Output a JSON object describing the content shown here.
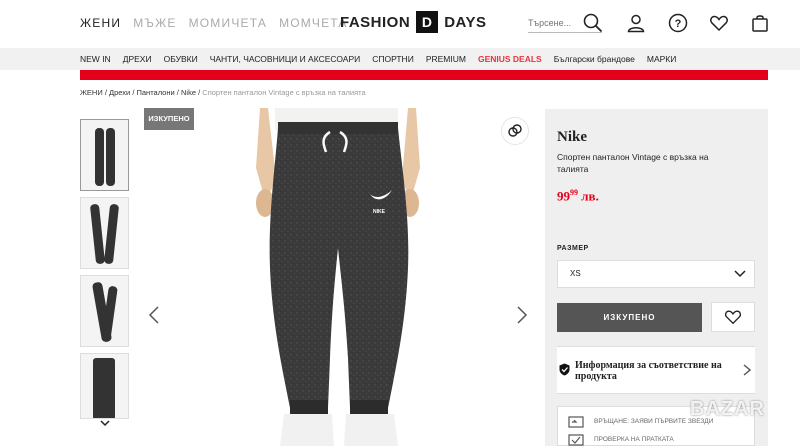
{
  "header": {
    "genders": [
      "ЖЕНИ",
      "МЪЖЕ",
      "МОМИЧЕТА",
      "МОМЧЕТА"
    ],
    "active_gender": "ЖЕНИ",
    "logo_left": "FASHION",
    "logo_right": "DAYS",
    "logo_mark": "D",
    "search_placeholder": "Търсене..."
  },
  "nav": {
    "items": [
      "NEW IN",
      "ДРЕХИ",
      "ОБУВКИ",
      "ЧАНТИ, ЧАСОВНИЦИ И АКСЕСОАРИ",
      "СПОРТНИ",
      "PREMIUM",
      "GENIUS DEALS",
      "Български брандове",
      "МАРКИ"
    ]
  },
  "breadcrumb": {
    "items": [
      "ЖЕНИ",
      "Дрехи",
      "Панталони",
      "Nike"
    ],
    "current": "Спортен панталон Vintage с връзка на талията",
    "separator": "/"
  },
  "gallery": {
    "sold_tag": "ИЗКУПЕНО",
    "thumbnail_count": 4,
    "garment_print": "NIKE"
  },
  "product": {
    "brand": "Nike",
    "name": "Спортен панталон Vintage с връзка на талията",
    "price_main": "99",
    "price_cents": "99",
    "currency": "лв.",
    "size_label": "РАЗМЕР",
    "selected_size": "XS",
    "sold_button": "ИЗКУПЕНО",
    "compliance_text": "Информация за съответствие на продукта",
    "info_rows": [
      "ВРЪЩАНЕ: ЗАЯВИ ПЪРВИТЕ ЗВЕЗДИ",
      "ПРОВЕРКА НА ПРАТКАТА"
    ]
  },
  "colors": {
    "accent_red": "#e4001b",
    "deal_red": "#e8333c",
    "sold_gray": "#555555"
  },
  "watermark": "BAZAR"
}
